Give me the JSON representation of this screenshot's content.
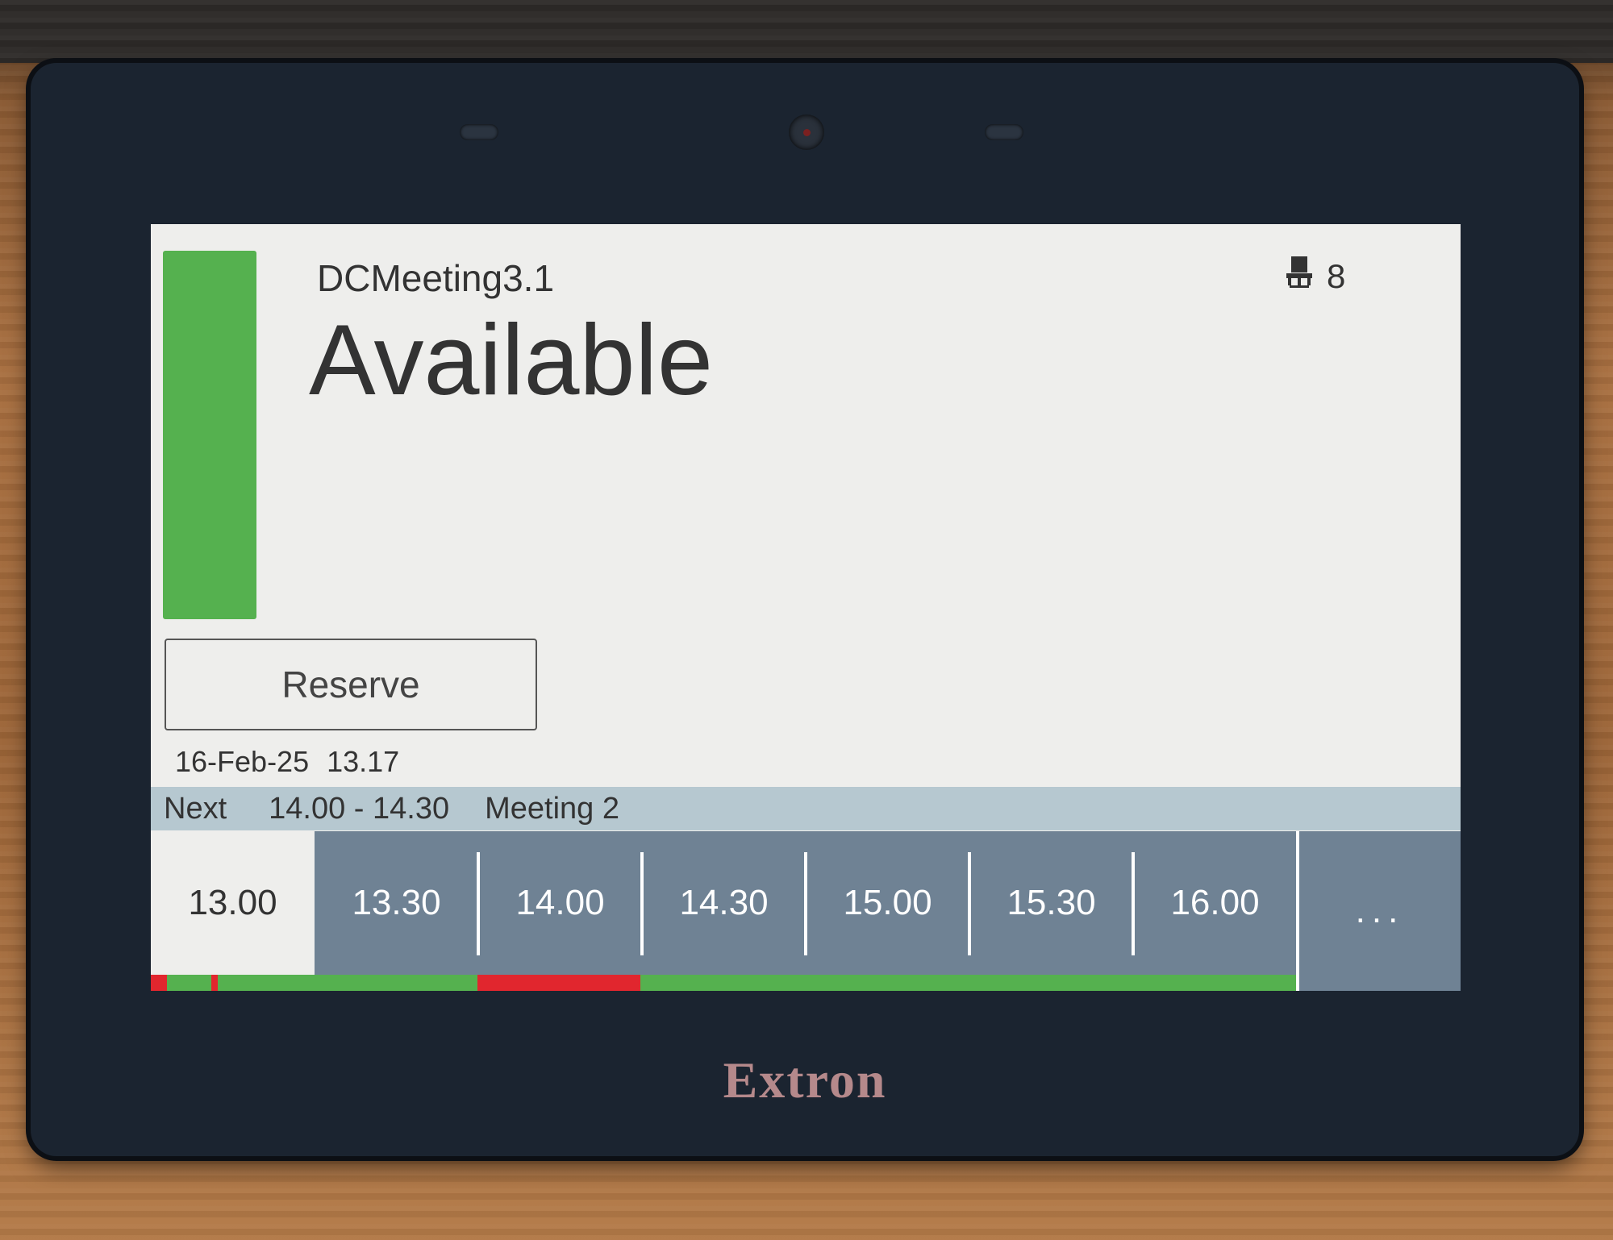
{
  "room": {
    "name": "DCMeeting3.1",
    "status": "Available",
    "capacity": "8",
    "capacity_icon": "chair-icon",
    "status_color": "#55b14f"
  },
  "actions": {
    "reserve_label": "Reserve"
  },
  "clock": {
    "date": "16-Feb-25",
    "time": "13.17"
  },
  "next_meeting": {
    "label": "Next",
    "time_range": "14.00 - 14.30",
    "title": "Meeting 2"
  },
  "timeline": {
    "slots": [
      "13.00",
      "13.30",
      "14.00",
      "14.30",
      "15.00",
      "15.30",
      "16.00"
    ],
    "current_index": 0,
    "more_label": "...",
    "occupancy_colors": {
      "free": "#55b14f",
      "booked": "#e1262e"
    }
  },
  "device": {
    "brand": "Extron"
  }
}
